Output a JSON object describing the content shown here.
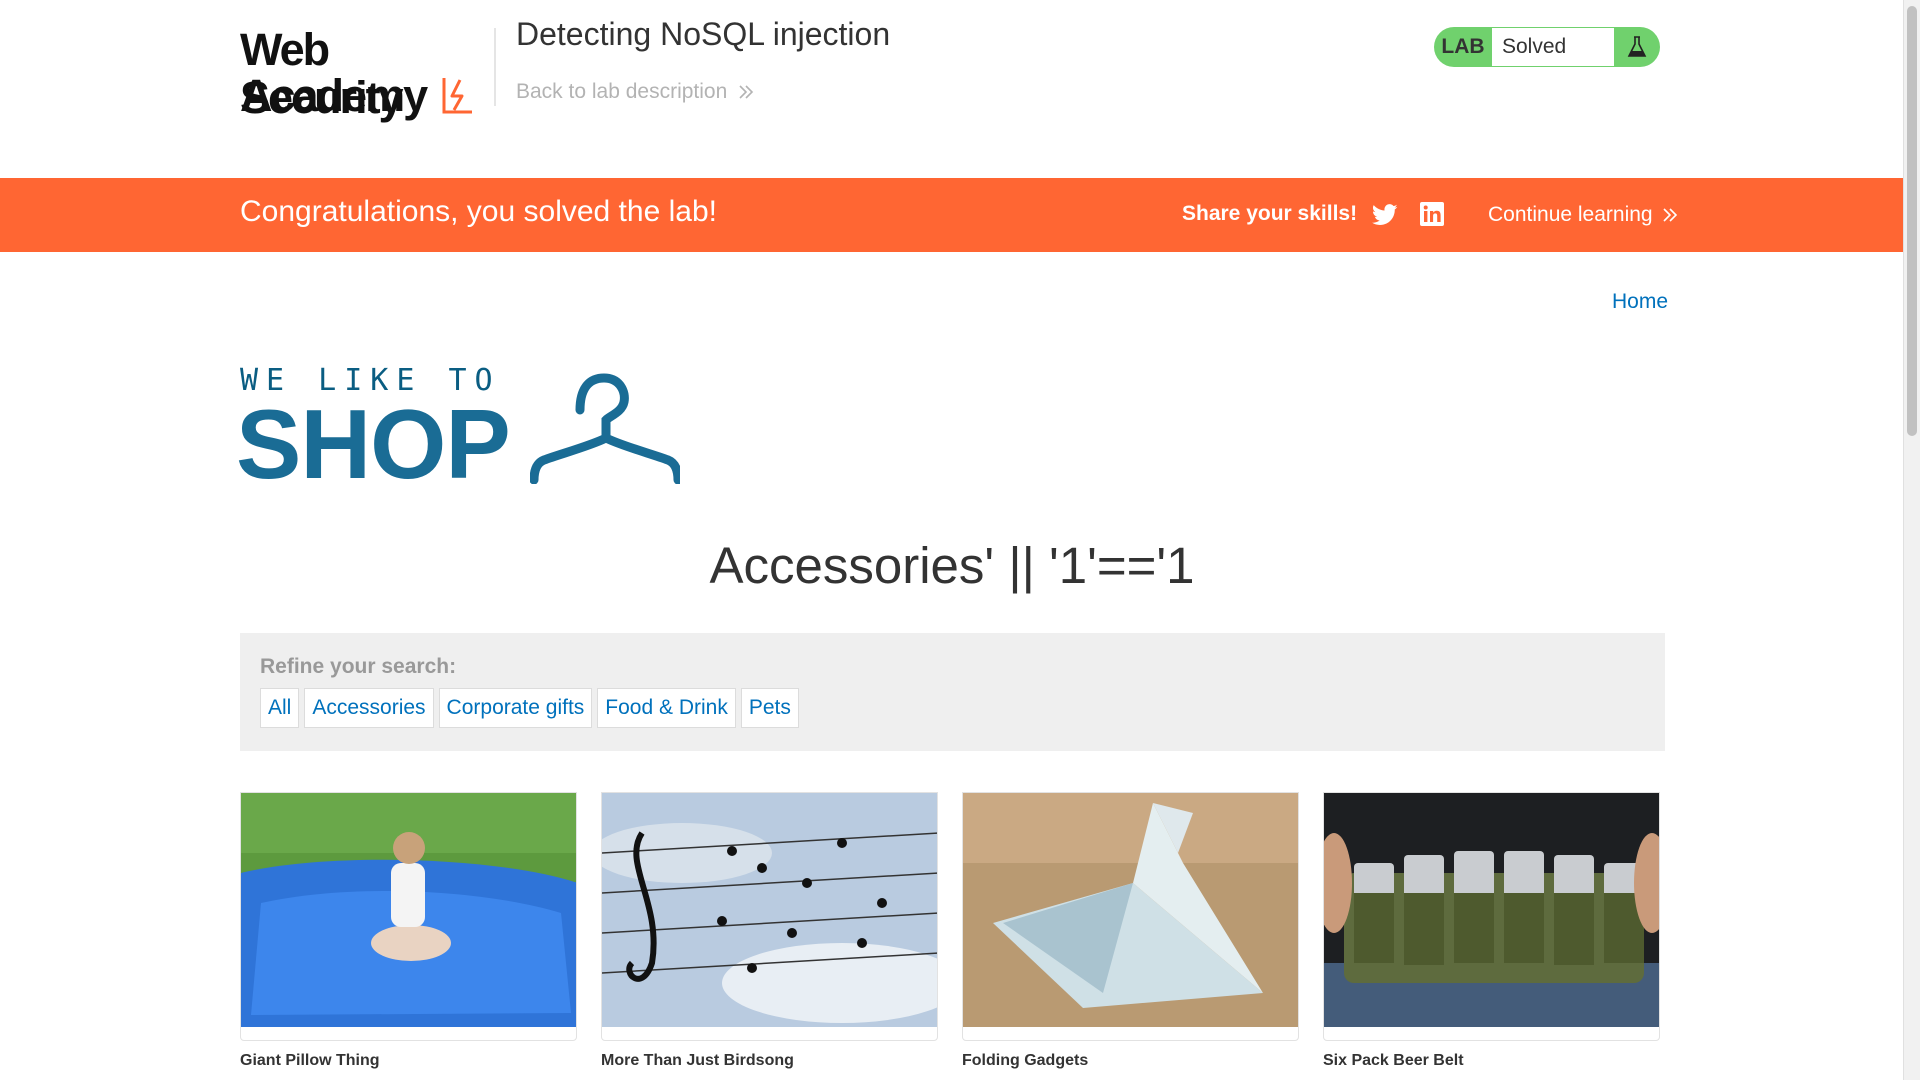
{
  "header": {
    "logo_line1": "Web Security",
    "logo_line2": "Academy",
    "lab_title": "Detecting NoSQL injection",
    "back_link": "Back to lab description"
  },
  "lab_status": {
    "label": "LAB",
    "state": "Solved",
    "accent_color": "#70d16d"
  },
  "banner": {
    "message": "Congratulations, you solved the lab!",
    "share_label": "Share your skills!",
    "continue_label": "Continue learning",
    "color": "#ff6633",
    "icons": [
      "twitter-icon",
      "linkedin-icon"
    ]
  },
  "nav": {
    "home": "Home"
  },
  "shop_logo": {
    "top_text": "WE LIKE TO",
    "big_text": "SHOP"
  },
  "search": {
    "title": "Accessories' || '1'=='1"
  },
  "filters": {
    "label": "Refine your search:",
    "items": [
      "All",
      "Accessories",
      "Corporate gifts",
      "Food & Drink",
      "Pets"
    ]
  },
  "products": [
    {
      "name": "Giant Pillow Thing",
      "image": "blue-beanbag-pillow"
    },
    {
      "name": "More Than Just Birdsong",
      "image": "birds-on-wires-music-notes"
    },
    {
      "name": "Folding Gadgets",
      "image": "origami-banknote-bird"
    },
    {
      "name": "Six Pack Beer Belt",
      "image": "camo-beer-can-belt"
    }
  ]
}
